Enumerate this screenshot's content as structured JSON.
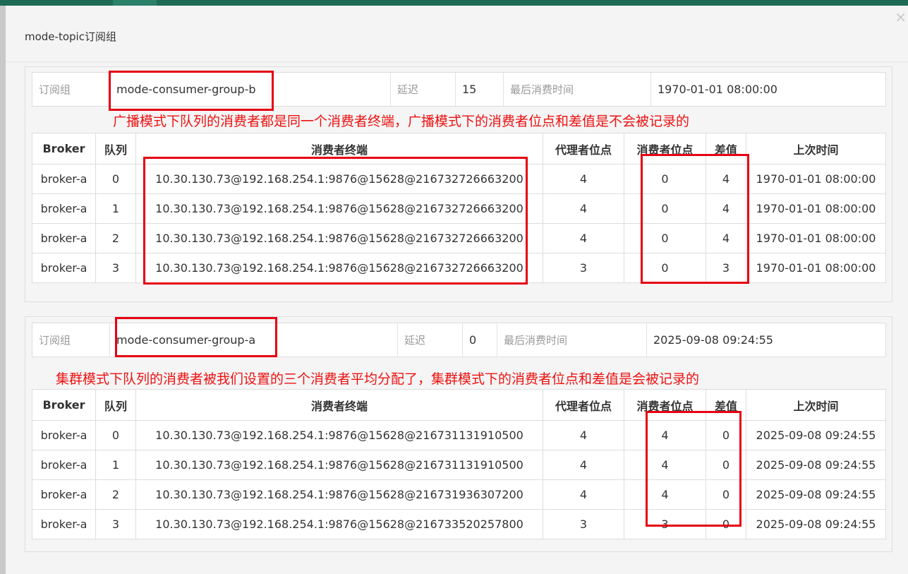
{
  "dialog": {
    "title": "mode-topic订阅组",
    "close_label": "×"
  },
  "labels": {
    "group": "订阅组",
    "delay": "延迟",
    "last_consume_time": "最后消费时间"
  },
  "columns": [
    "Broker",
    "队列",
    "消费者终端",
    "代理者位点",
    "消费者位点",
    "差值",
    "上次时间"
  ],
  "groups": [
    {
      "group_name": "mode-consumer-group-b",
      "delay": "15",
      "last_consume_time": "1970-01-01 08:00:00",
      "note": "广播模式下队列的消费者都是同一个消费者终端，广播模式下的消费者位点和差值是不会被记录的",
      "rows": [
        [
          "broker-a",
          "0",
          "10.30.130.73@192.168.254.1:9876@15628@216732726663200",
          "4",
          "0",
          "4",
          "1970-01-01 08:00:00"
        ],
        [
          "broker-a",
          "1",
          "10.30.130.73@192.168.254.1:9876@15628@216732726663200",
          "4",
          "0",
          "4",
          "1970-01-01 08:00:00"
        ],
        [
          "broker-a",
          "2",
          "10.30.130.73@192.168.254.1:9876@15628@216732726663200",
          "4",
          "0",
          "4",
          "1970-01-01 08:00:00"
        ],
        [
          "broker-a",
          "3",
          "10.30.130.73@192.168.254.1:9876@15628@216732726663200",
          "3",
          "0",
          "3",
          "1970-01-01 08:00:00"
        ]
      ]
    },
    {
      "group_name": "mode-consumer-group-a",
      "delay": "0",
      "last_consume_time": "2025-09-08 09:24:55",
      "note": "集群模式下队列的消费者被我们设置的三个消费者平均分配了，集群模式下的消费者位点和差值是会被记录的",
      "rows": [
        [
          "broker-a",
          "0",
          "10.30.130.73@192.168.254.1:9876@15628@216731131910500",
          "4",
          "4",
          "0",
          "2025-09-08 09:24:55"
        ],
        [
          "broker-a",
          "1",
          "10.30.130.73@192.168.254.1:9876@15628@216731131910500",
          "4",
          "4",
          "0",
          "2025-09-08 09:24:55"
        ],
        [
          "broker-a",
          "2",
          "10.30.130.73@192.168.254.1:9876@15628@216731936307200",
          "4",
          "4",
          "0",
          "2025-09-08 09:24:55"
        ],
        [
          "broker-a",
          "3",
          "10.30.130.73@192.168.254.1:9876@15628@216733520257800",
          "3",
          "3",
          "0",
          "2025-09-08 09:24:55"
        ]
      ]
    }
  ],
  "colors": {
    "topbar": "#1d6b55",
    "annotation": "#e60012",
    "note_text": "#ee1111"
  }
}
